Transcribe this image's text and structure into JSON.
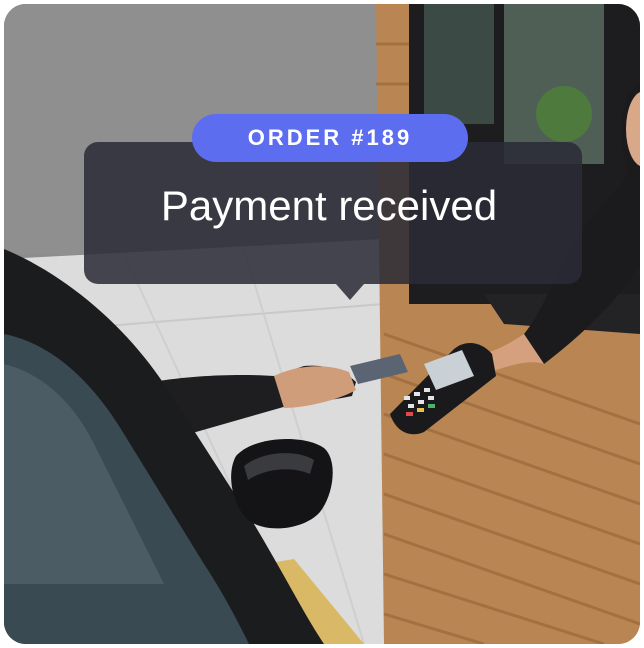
{
  "notification": {
    "order_label": "ORDER #189",
    "message": "Payment received"
  },
  "colors": {
    "badge_bg": "#5d6df0",
    "bubble_bg": "#2b2b37",
    "text": "#ffffff"
  }
}
